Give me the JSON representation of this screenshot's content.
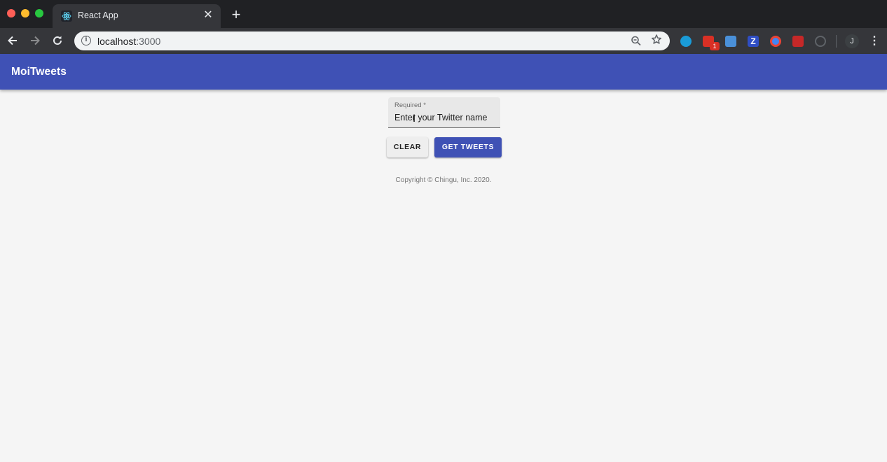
{
  "browser": {
    "tab_title": "React App",
    "tab_close": "✕",
    "new_tab": "+",
    "url_host": "localhost",
    "url_port": ":3000",
    "info_glyph": "i",
    "extensions": [
      {
        "name": "blue-circle-extension-icon",
        "color": "#1a9bd7"
      },
      {
        "name": "mail-extension-icon",
        "color": "#d93025",
        "badge": "1"
      },
      {
        "name": "folder-extension-icon",
        "color": "#4a90d9"
      },
      {
        "name": "zotero-extension-icon",
        "color": "#2f4ec4"
      },
      {
        "name": "chrome-ring-extension-icon",
        "color": "#ea4335"
      },
      {
        "name": "red-cube-extension-icon",
        "color": "#c62828"
      },
      {
        "name": "gray-circle-extension-icon",
        "color": "#5f6368"
      }
    ],
    "profile_initial": "J"
  },
  "app": {
    "title": "MoiTweets",
    "brand_color": "#3f51b5"
  },
  "form": {
    "label": "Required *",
    "placeholder": "Enter your Twitter name",
    "clear_label": "CLEAR",
    "submit_label": "GET TWEETS"
  },
  "footer": {
    "copyright": "Copyright © Chingu, Inc. 2020."
  }
}
